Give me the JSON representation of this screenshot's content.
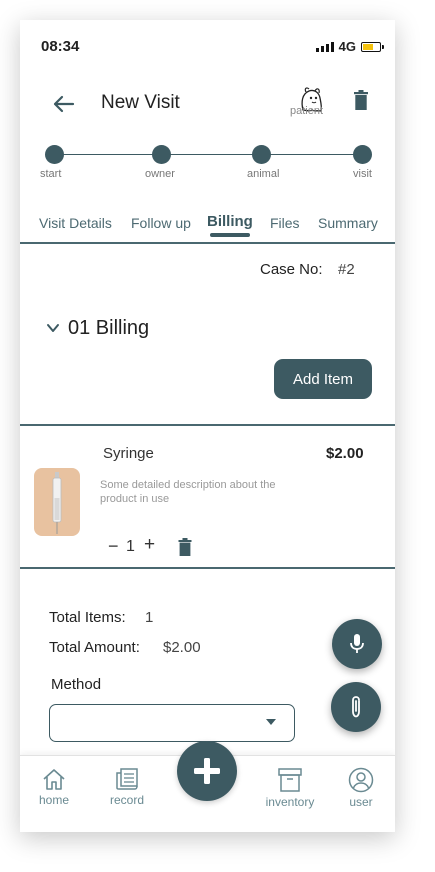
{
  "status": {
    "time": "08:34",
    "network": "4G"
  },
  "header": {
    "title": "New Visit",
    "patient_label": "patient"
  },
  "steps": [
    "start",
    "owner",
    "animal",
    "visit"
  ],
  "tabs": [
    "Visit Details",
    "Follow up",
    "Billing",
    "Files",
    "Summary"
  ],
  "active_tab": "Billing",
  "case": {
    "label": "Case No:",
    "number": "#2"
  },
  "billing": {
    "heading": "01 Billing",
    "add_label": "Add Item"
  },
  "item": {
    "name": "Syringe",
    "price": "$2.00",
    "description": "Some detailed description about the product in use",
    "quantity": "1",
    "minus": "−",
    "plus": "+"
  },
  "totals": {
    "items_label": "Total Items:",
    "items_value": "1",
    "amount_label": "Total Amount:",
    "amount_value": "$2.00"
  },
  "method": {
    "label": "Method",
    "value": ""
  },
  "nav": {
    "home": "home",
    "record": "record",
    "inventory": "inventory",
    "user": "user"
  },
  "colors": {
    "primary": "#3d5a62",
    "battery": "#f4c20d"
  }
}
